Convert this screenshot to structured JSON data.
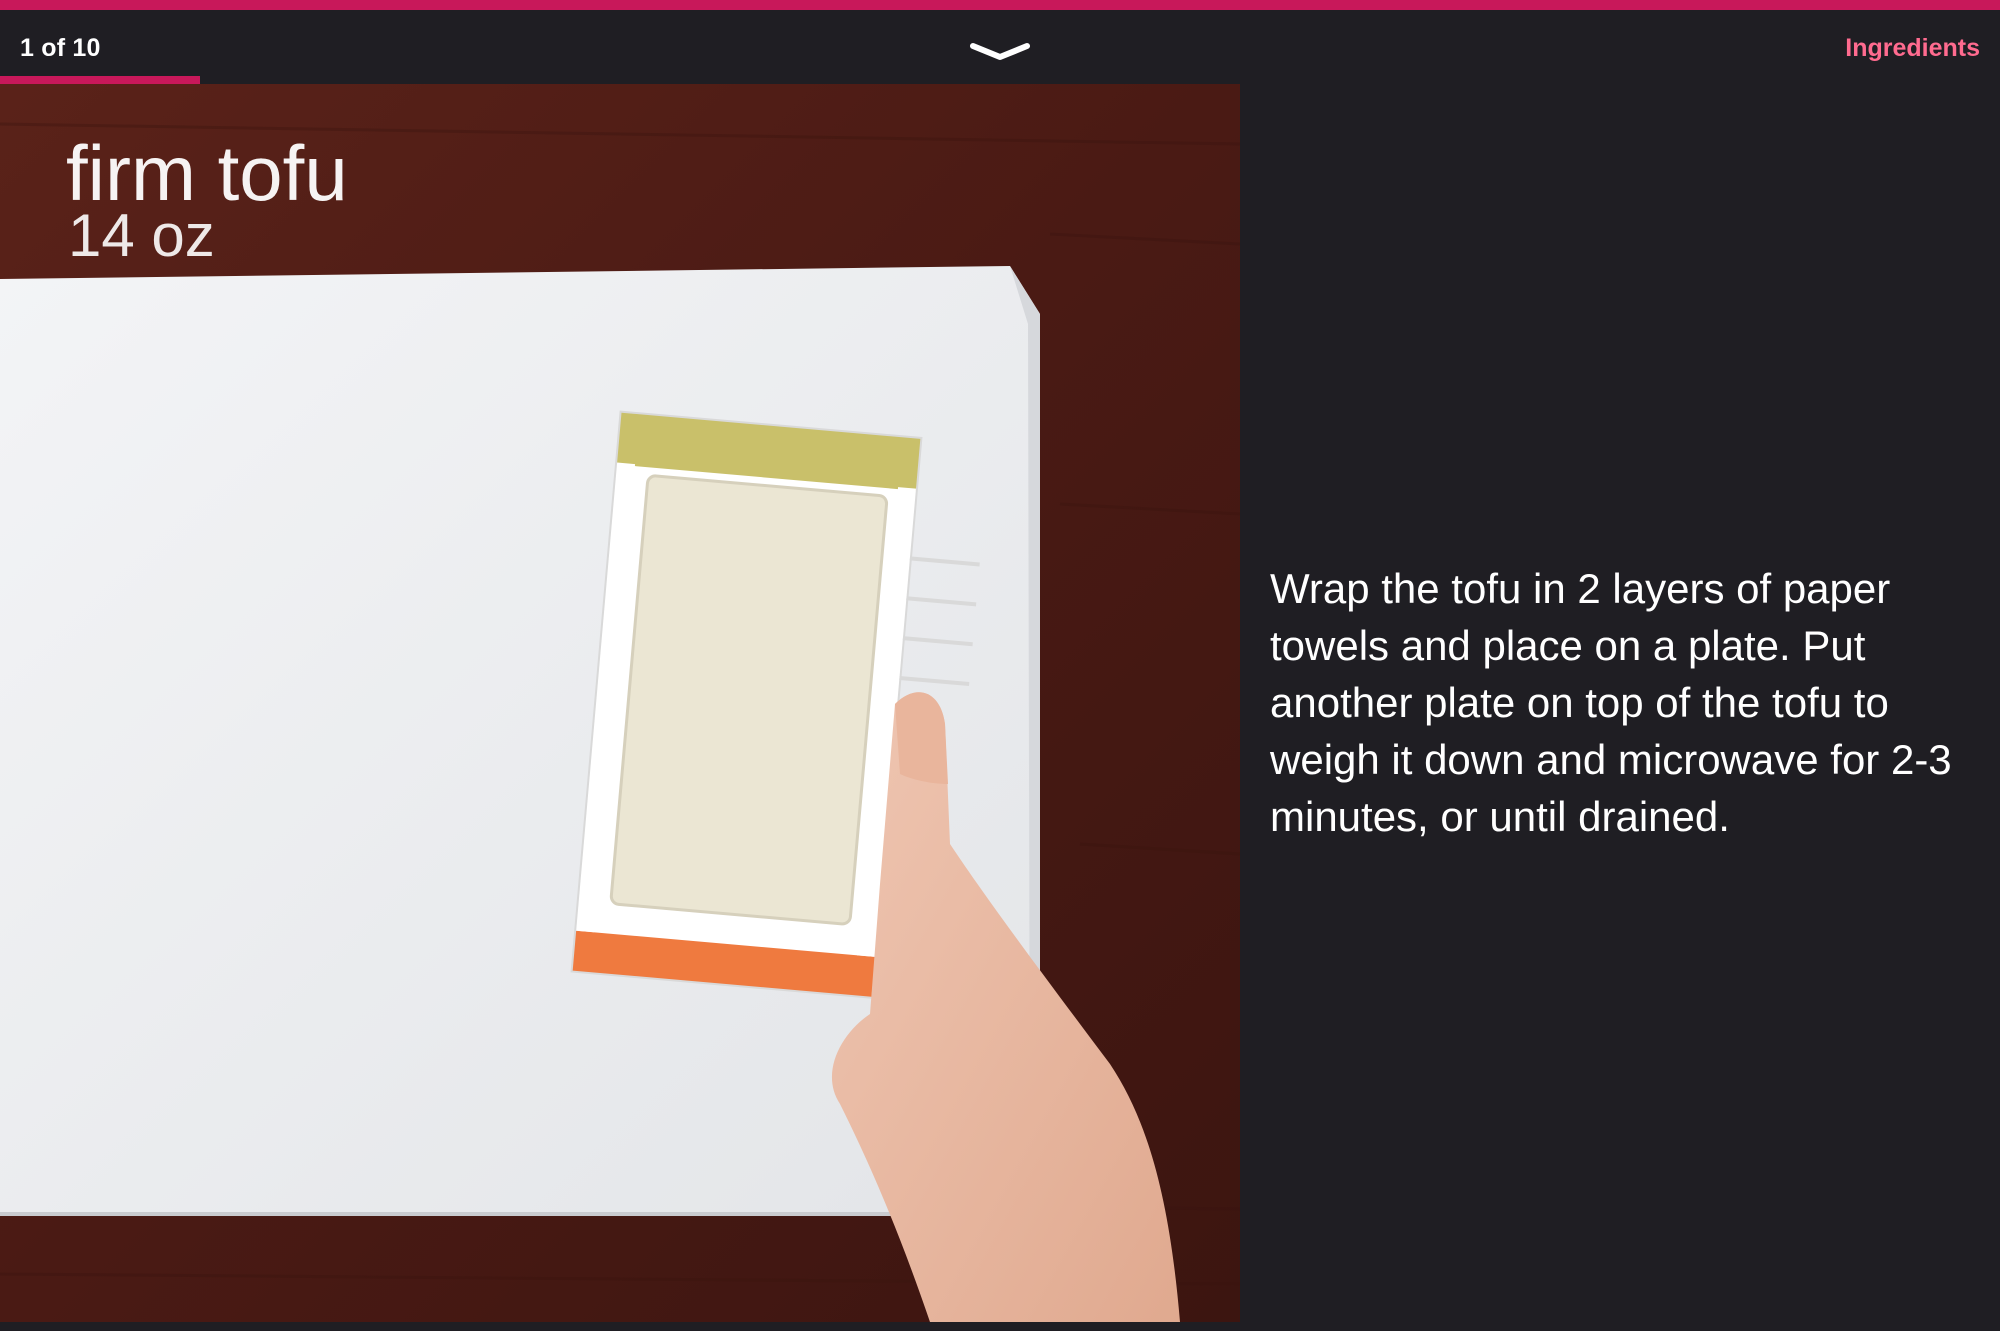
{
  "header": {
    "step_counter": "1 of 10",
    "ingredients_label": "Ingredients",
    "collapse_icon": "chevron-down-icon",
    "progress": 0.1
  },
  "media": {
    "overlay_name": "firm tofu",
    "overlay_quantity": "14 oz"
  },
  "step": {
    "text": "Wrap the tofu in 2 layers of paper towels and place on a plate. Put another plate on top of the tofu to weigh it down and microwave for 2-3 minutes, or until drained."
  },
  "colors": {
    "accent": "#c8185a",
    "link": "#ff6b8f",
    "background": "#1f1e23"
  }
}
